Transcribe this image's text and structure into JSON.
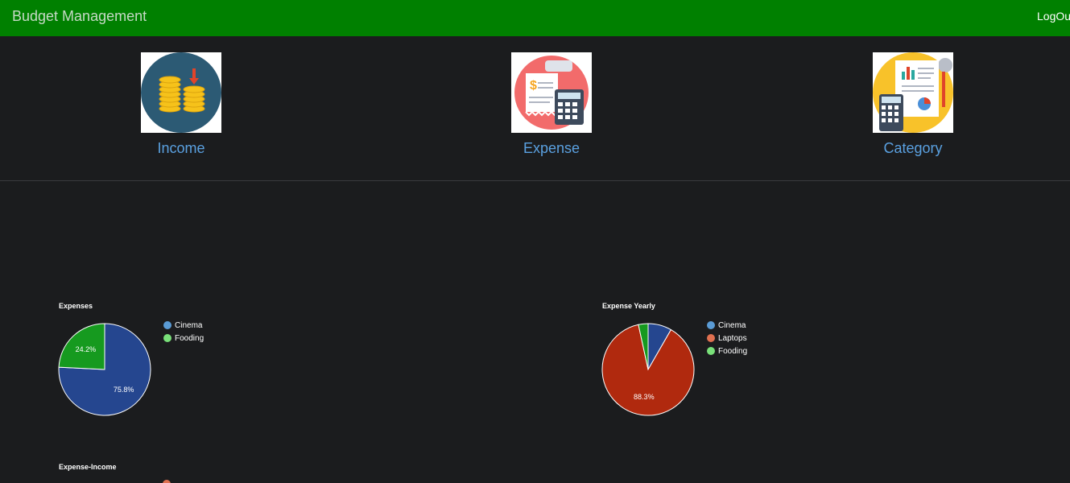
{
  "navbar": {
    "brand": "Budget Management",
    "logout": "LogOut",
    "color": "#008000"
  },
  "tiles": [
    {
      "label": "Income",
      "icon": "coins-icon"
    },
    {
      "label": "Expense",
      "icon": "receipt-calculator-icon"
    },
    {
      "label": "Category",
      "icon": "report-calculator-icon"
    }
  ],
  "charts": {
    "expenses": {
      "title": "Expenses",
      "legend": [
        {
          "label": "Cinema",
          "color": "#5a9bd5"
        },
        {
          "label": "Fooding",
          "color": "#79e079"
        }
      ],
      "label_75": "75.8%",
      "label_24": "24.2%"
    },
    "expense_yearly": {
      "title": "Expense Yearly",
      "legend": [
        {
          "label": "Cinema",
          "color": "#5a9bd5"
        },
        {
          "label": "Laptops",
          "color": "#e07050"
        },
        {
          "label": "Fooding",
          "color": "#79e079"
        }
      ],
      "label_88": "88.3%"
    },
    "expense_income": {
      "title": "Expense-Income"
    }
  },
  "chart_data": [
    {
      "type": "pie",
      "title": "Expenses",
      "categories": [
        "Cinema",
        "Fooding"
      ],
      "values": [
        75.8,
        24.2
      ],
      "colors": [
        "#25468f",
        "#169a1f"
      ]
    },
    {
      "type": "pie",
      "title": "Expense Yearly",
      "categories": [
        "Cinema",
        "Laptops",
        "Fooding"
      ],
      "values": [
        8.3,
        88.3,
        3.4
      ],
      "colors": [
        "#25468f",
        "#b0290e",
        "#169a1f"
      ]
    }
  ]
}
